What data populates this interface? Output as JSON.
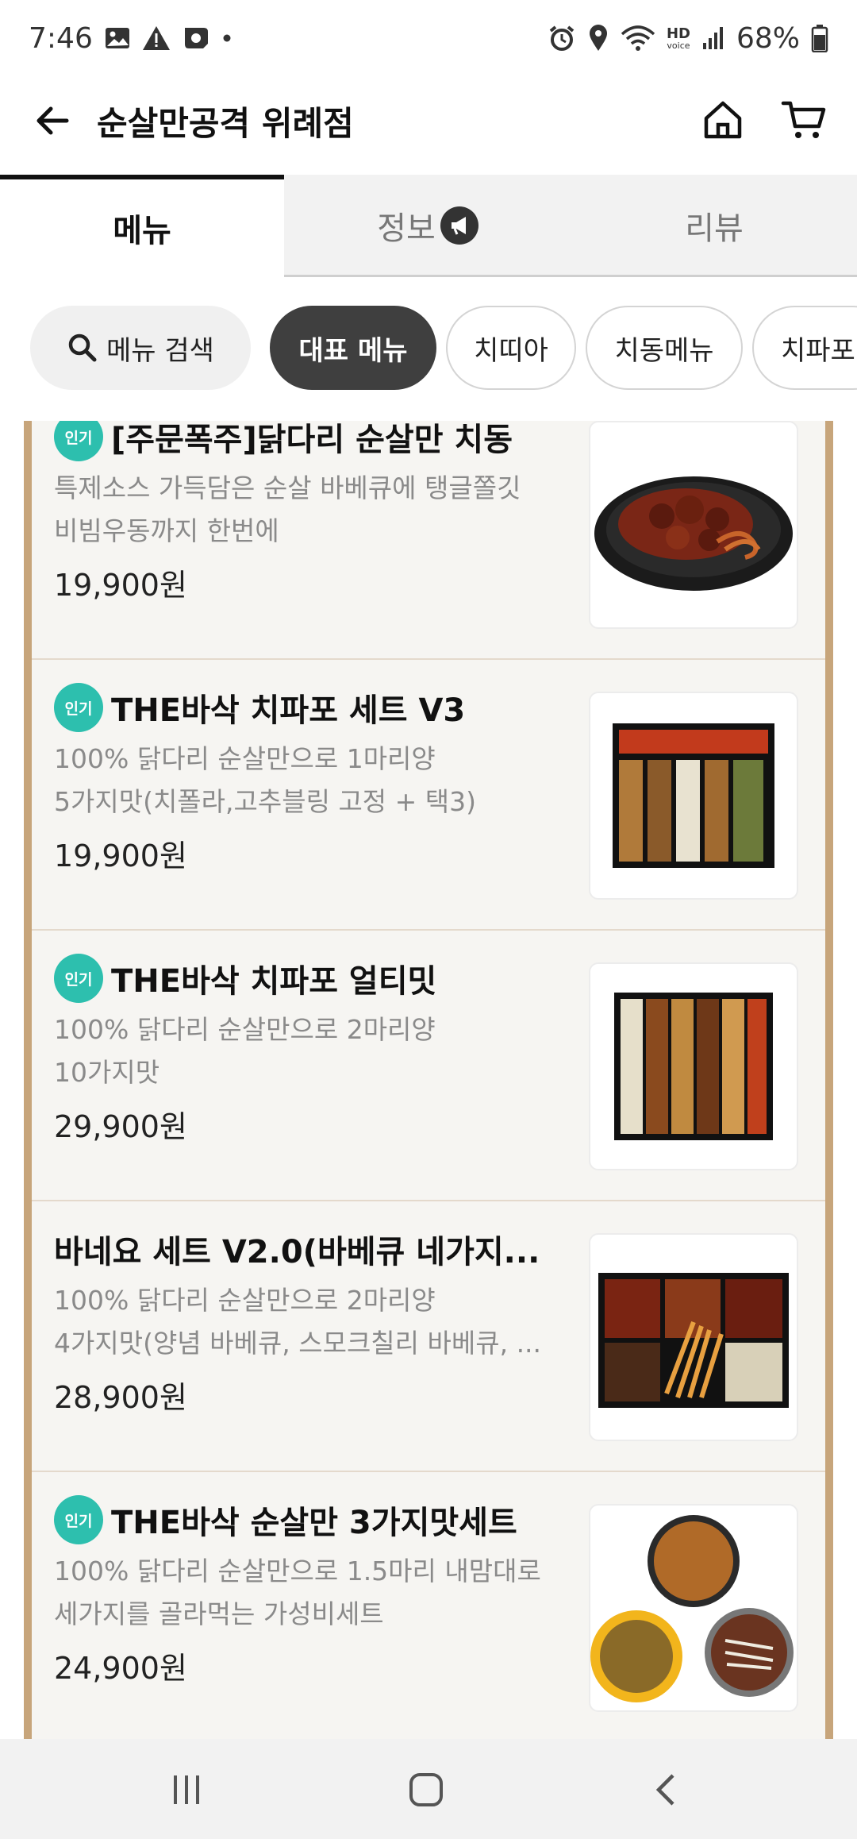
{
  "status": {
    "time": "7:46",
    "battery": "68%",
    "left_icons": [
      "gallery-icon",
      "warning-icon",
      "messenger-icon",
      "dot-icon"
    ],
    "right_icons": [
      "alarm-icon",
      "location-icon",
      "wifi-icon",
      "hd-voice-icon",
      "signal-icon",
      "battery-icon"
    ],
    "hd_label": "HD",
    "voice_label": "voice"
  },
  "appbar": {
    "title": "순살만공격 위례점"
  },
  "tabs": [
    {
      "label": "메뉴"
    },
    {
      "label": "정보"
    },
    {
      "label": "리뷰"
    }
  ],
  "chips": {
    "search": "메뉴 검색",
    "items": [
      "대표 메뉴",
      "치띠아",
      "치동메뉴",
      "치파포"
    ]
  },
  "menu": {
    "badge": "인기",
    "items": [
      {
        "name": "[주문폭주]닭다리 순살만 치동",
        "desc": [
          "특제소스 가득담은 순살 바베큐에 탱글쫄깃",
          "비빔우동까지 한번에"
        ],
        "price": "19,900원",
        "badge": true
      },
      {
        "name": "THE바삭 치파포 세트 V3",
        "desc": [
          "100% 닭다리 순살만으로 1마리양",
          "5가지맛(치폴라,고추블링 고정 + 택3)"
        ],
        "price": "19,900원",
        "badge": true
      },
      {
        "name": "THE바삭 치파포 얼티밋",
        "desc": [
          "100% 닭다리 순살만으로  2마리양",
          "10가지맛"
        ],
        "price": "29,900원",
        "badge": true
      },
      {
        "name": "바네요 세트 V2.0(바베큐 네가지...",
        "desc": [
          "100% 닭다리 순살만으로 2마리양",
          "4가지맛(양념 바베큐, 스모크칠리 바베큐, ..."
        ],
        "price": "28,900원",
        "badge": false
      },
      {
        "name": "THE바삭 순살만 3가지맛세트",
        "desc": [
          "100% 닭다리 순살만으로 1.5마리 내맘대로",
          "세가지를 골라먹는 가성비세트"
        ],
        "price": "24,900원",
        "badge": true
      }
    ]
  },
  "colors": {
    "badge": "#2dbfae",
    "frame": "#c7a57b",
    "active_chip": "#3f3f3f"
  }
}
